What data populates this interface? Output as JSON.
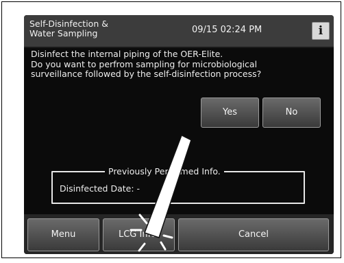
{
  "header": {
    "title": "Self-Disinfection &\nWater Sampling",
    "datetime": "09/15 02:24 PM",
    "info_icon_label": "i"
  },
  "message": {
    "lines": [
      "Disinfect the internal piping of the OER-Elite.",
      "Do you want to perfrom sampling for microbiological",
      "surveillance followed by the self-disinfection process?"
    ]
  },
  "dialog": {
    "yes_label": "Yes",
    "no_label": "No"
  },
  "info_panel": {
    "title": "Previously Performed Info.",
    "disinfected_date": "Disinfected Date: -"
  },
  "bottom_bar": {
    "menu_label": "Menu",
    "lcg_info_label": "LCG Info.",
    "cancel_label": "Cancel"
  },
  "colors": {
    "screen_background": "#0b0b0b",
    "header_background": "#3c3c3c",
    "button_gradient_top": "#6a6a6a",
    "button_gradient_bottom": "#3a3a3a",
    "text": "#eeeeee"
  },
  "icons": [
    "info-icon",
    "stylus-pointer-icon",
    "tap-indicator-icon"
  ]
}
